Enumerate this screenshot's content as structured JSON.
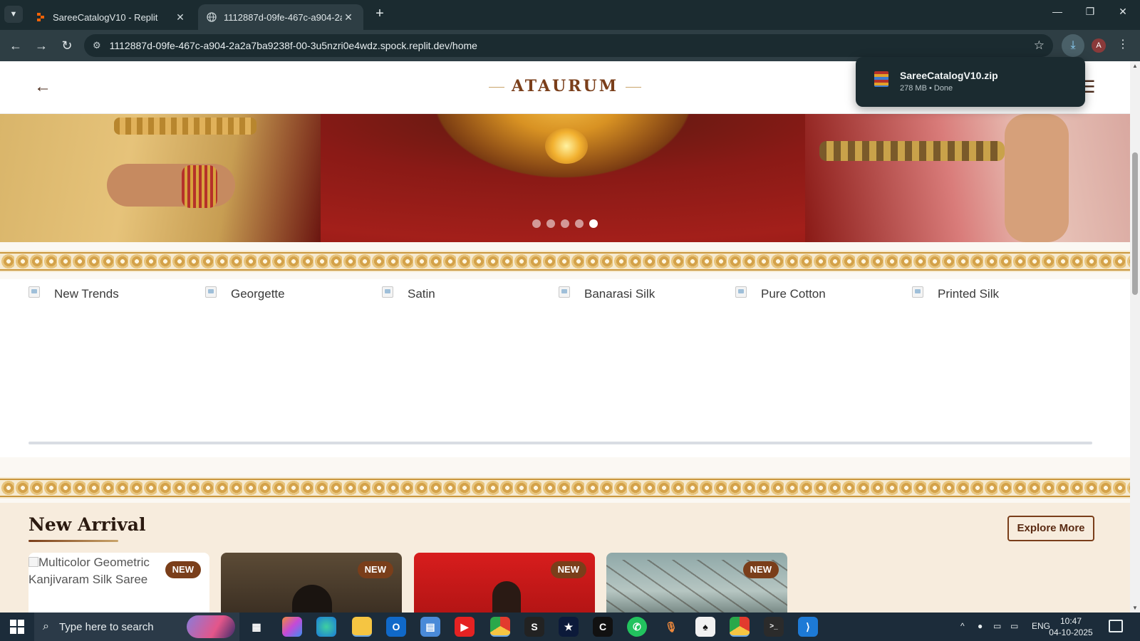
{
  "browser": {
    "tabs": [
      {
        "title": "SareeCatalogV10 - Replit",
        "favicon": "replit-icon"
      },
      {
        "title": "1112887d-09fe-467c-a904-2a2",
        "favicon": "globe-icon",
        "active": true
      }
    ],
    "url": "1112887d-09fe-467c-a904-2a2a7ba9238f-00-3u5nzri0e4wdz.spock.replit.dev/home",
    "avatar_letter": "A",
    "download": {
      "file_name": "SareeCatalogV10.zip",
      "meta": "278 MB • Done"
    }
  },
  "site": {
    "brand": "ATAURUM",
    "hero": {
      "slide_count": 5,
      "active_slide": 5
    },
    "categories": [
      "New Trends",
      "Georgette",
      "Satin",
      "Banarasi Silk",
      "Pure Cotton",
      "Printed Silk"
    ],
    "new_arrival": {
      "title": "New Arrival",
      "explore_label": "Explore More",
      "products": [
        {
          "alt": "Multicolor Geometric Kanjivaram Silk Saree",
          "badge": "NEW"
        },
        {
          "badge": "NEW"
        },
        {
          "badge": "NEW"
        },
        {
          "badge": "NEW"
        }
      ]
    }
  },
  "taskbar": {
    "search_placeholder": "Type here to search",
    "language": "ENG",
    "time": "10:47",
    "date": "04-10-2025"
  },
  "colors": {
    "brand": "#7a3e1a",
    "chrome_dark": "#1b2b30",
    "page_bg": "#fbf8f3",
    "arrival_bg": "#f7ecdd",
    "gold": "#c9963c"
  }
}
